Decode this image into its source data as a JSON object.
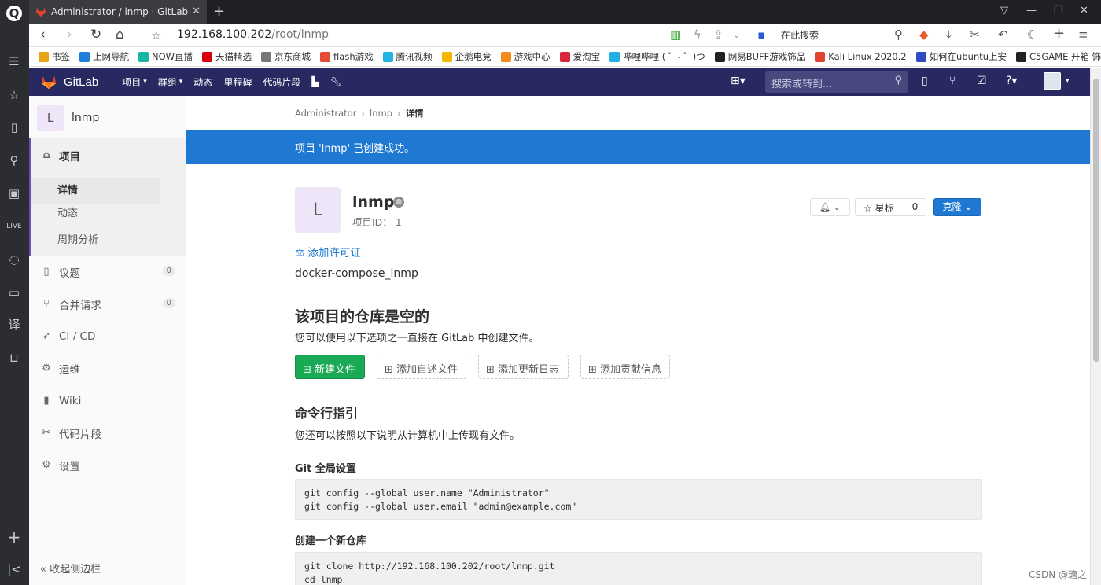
{
  "browser": {
    "tab_title": "Administrator / lnmp · GitLab",
    "url_host": "192.168.100.202",
    "url_path": "/root/lnmp",
    "search_placeholder": "在此搜索",
    "bookmarks": [
      {
        "label": "书签",
        "color": "#e8a317"
      },
      {
        "label": "上网导航",
        "color": "#1d7fd7"
      },
      {
        "label": "NOW直播",
        "color": "#19b5a4"
      },
      {
        "label": "天猫精选",
        "color": "#d7000f"
      },
      {
        "label": "京东商城",
        "color": "#777777"
      },
      {
        "label": "flash游戏",
        "color": "#e64a35"
      },
      {
        "label": "腾讯视频",
        "color": "#20b5e3"
      },
      {
        "label": "企鹅电竞",
        "color": "#f5b400"
      },
      {
        "label": "游戏中心",
        "color": "#f28b1c"
      },
      {
        "label": "爱淘宝",
        "color": "#d9253a"
      },
      {
        "label": "哔哩哔哩 ( ゜- ゜)つ",
        "color": "#23ade5"
      },
      {
        "label": "网易BUFF游戏饰品",
        "color": "#222222"
      },
      {
        "label": "Kali Linux 2020.2",
        "color": "#e04431"
      },
      {
        "label": "如何在ubuntu上安",
        "color": "#2d4bc4"
      },
      {
        "label": "C5GAME 开箱 饰",
        "color": "#222222"
      }
    ]
  },
  "gitlab": {
    "brand": "GitLab",
    "nav": [
      "项目",
      "群组",
      "动态",
      "里程碑",
      "代码片段"
    ],
    "search_placeholder": "搜索或转到..."
  },
  "sidebar": {
    "project_initial": "L",
    "project_name": "lnmp",
    "project_section": "项目",
    "sub_items": [
      "详情",
      "动态",
      "周期分析"
    ],
    "issues": {
      "label": "议题",
      "count": "0"
    },
    "merge_requests": {
      "label": "合并请求",
      "count": "0"
    },
    "cicd": "CI / CD",
    "operations": "运维",
    "wiki": "Wiki",
    "snippets": "代码片段",
    "settings": "设置",
    "collapse": "收起侧边栏"
  },
  "main": {
    "breadcrumb": [
      "Administrator",
      "lnmp",
      "详情"
    ],
    "flash": "项目 'lnmp' 已创建成功。",
    "project_initial": "L",
    "project_name": "lnmp",
    "project_id": "项目ID： 1",
    "star_label": "星标",
    "star_count": "0",
    "clone_label": "克隆",
    "add_license": "添加许可证",
    "description": "docker-compose_lnmp",
    "empty_heading": "该项目的仓库是空的",
    "empty_text": "您可以使用以下选项之一直接在 GitLab 中创建文件。",
    "actions": [
      "新建文件",
      "添加自述文件",
      "添加更新日志",
      "添加贡献信息"
    ],
    "cmd_heading": "命令行指引",
    "cmd_text": "您还可以按照以下说明从计算机中上传现有文件。",
    "git_global_heading": "Git 全局设置",
    "git_global_code": "git config --global user.name \"Administrator\"\ngit config --global user.email \"admin@example.com\"",
    "new_repo_heading": "创建一个新仓库",
    "new_repo_code": "git clone http://192.168.100.202/root/lnmp.git\ncd lnmp"
  },
  "watermark": "CSDN @瑭之"
}
